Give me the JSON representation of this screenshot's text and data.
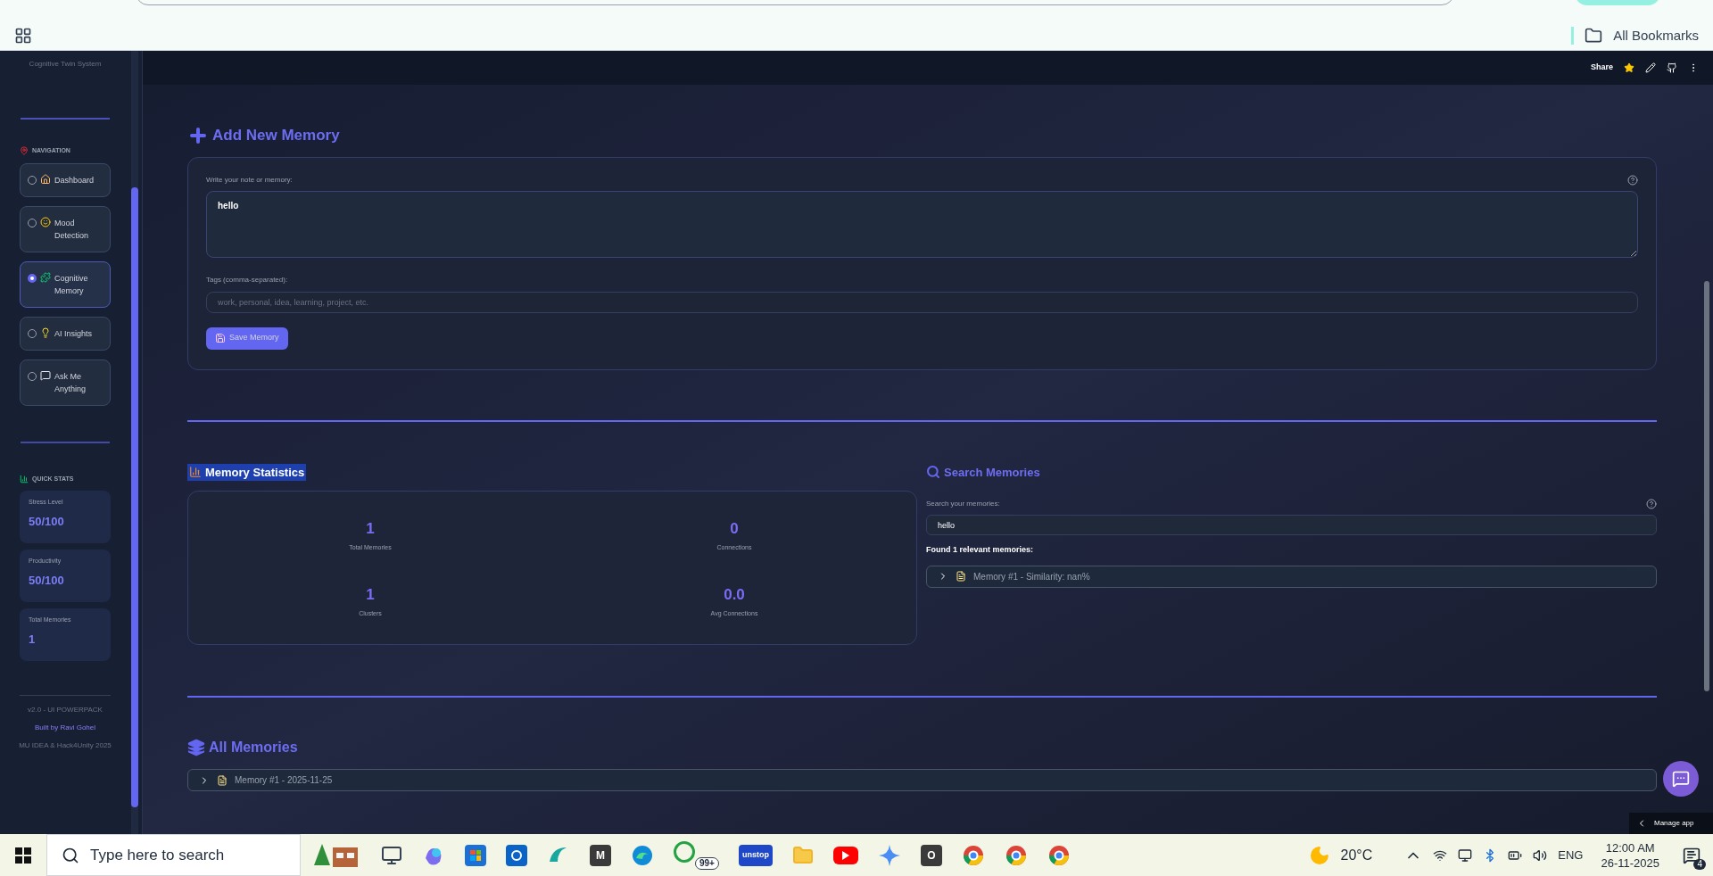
{
  "browser": {
    "bookmarks_label": "All Bookmarks"
  },
  "sidebar": {
    "title": "Cognitive Twin System",
    "nav_heading": "NAVIGATION",
    "nav_items": [
      {
        "label": "Dashboard",
        "kind": "house",
        "selected": false
      },
      {
        "label": "Mood Detection",
        "kind": "smile",
        "selected": false
      },
      {
        "label": "Cognitive Memory",
        "kind": "puzzle",
        "selected": true
      },
      {
        "label": "AI Insights",
        "kind": "bulb",
        "selected": false
      },
      {
        "label": "Ask Me Anything",
        "kind": "speech",
        "selected": false
      }
    ],
    "stats_heading": "QUICK STATS",
    "stats": [
      {
        "label": "Stress Level",
        "value": "50/100"
      },
      {
        "label": "Productivity",
        "value": "50/100"
      },
      {
        "label": "Total Memories",
        "value": "1"
      }
    ],
    "footer": {
      "version": "v2.0 - UI POWERPACK",
      "credit": "Built by Ravi Gohel",
      "event": "MU IDEA & Hack4Unity 2025"
    }
  },
  "header": {
    "share": "Share"
  },
  "add_memory": {
    "heading": "Add New Memory",
    "note_label": "Write your note or memory:",
    "note_value": "hello",
    "tags_label": "Tags (comma-separated):",
    "tags_placeholder": "work, personal, idea, learning, project, etc.",
    "save_button": "Save Memory"
  },
  "statistics": {
    "heading": "Memory Statistics",
    "items": [
      {
        "value": "1",
        "label": "Total Memories"
      },
      {
        "value": "0",
        "label": "Connections"
      },
      {
        "value": "1",
        "label": "Clusters"
      },
      {
        "value": "0.0",
        "label": "Avg Connections"
      }
    ]
  },
  "search": {
    "heading": "Search Memories",
    "label": "Search your memories:",
    "value": "hello",
    "result_text": "Found 1 relevant memories:",
    "results": [
      {
        "label": "Memory #1 - Similarity: nan%",
        "expanded": false
      }
    ]
  },
  "all_memories": {
    "heading": "All Memories",
    "items": [
      {
        "label": "Memory #1 - 2025-11-25",
        "expanded": false
      }
    ]
  },
  "manage_app": "Manage app",
  "taskbar": {
    "search_placeholder": "Type here to search",
    "apps": [
      {
        "kind": "tree"
      },
      {
        "kind": "taskview"
      },
      {
        "kind": "copilot"
      },
      {
        "kind": "store"
      },
      {
        "kind": "outlook"
      },
      {
        "kind": "wave"
      },
      {
        "kind": "letter",
        "label": "M"
      },
      {
        "kind": "edge"
      },
      {
        "kind": "whatsapp",
        "badge": "99+"
      },
      {
        "kind": "textlogo",
        "label": "unstop"
      },
      {
        "kind": "folder"
      },
      {
        "kind": "youtube"
      },
      {
        "kind": "sparkle"
      },
      {
        "kind": "letter",
        "label": "O"
      },
      {
        "kind": "chrome"
      },
      {
        "kind": "chrome"
      },
      {
        "kind": "chrome"
      }
    ],
    "weather": "20°C",
    "language": "ENG",
    "time": "12:00 AM",
    "date": "26-11-2025",
    "notifications": "4"
  }
}
